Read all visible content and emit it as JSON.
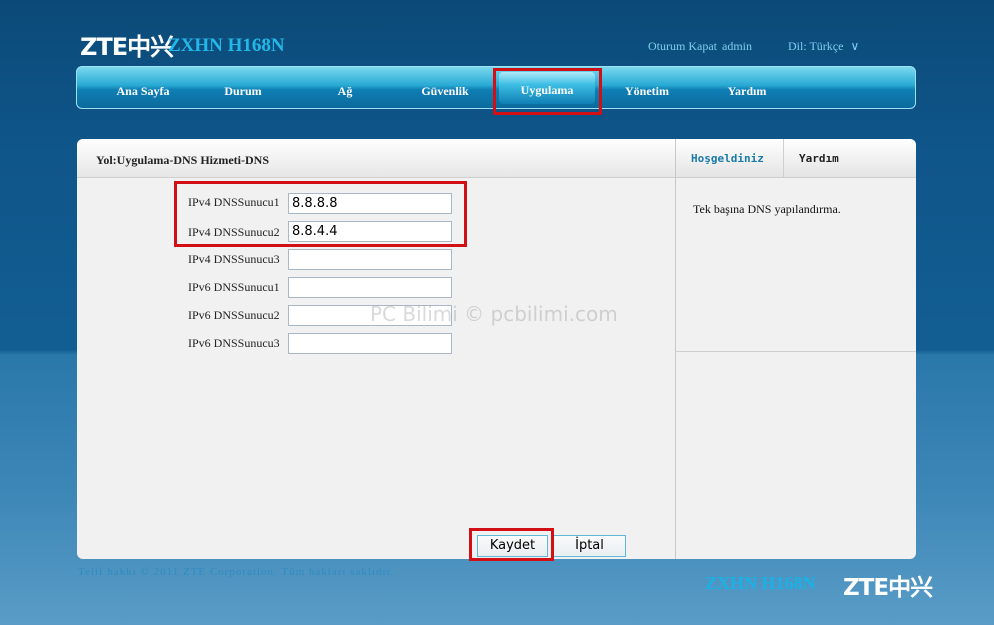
{
  "brand": {
    "logo_text": "ZTE中兴",
    "model": "ZXHN H168N"
  },
  "top_links": {
    "logout": "Oturum Kapat",
    "user": "admin",
    "language": "Dil: Türkçe",
    "language_caret": "∨"
  },
  "nav": [
    "Ana Sayfa",
    "Durum",
    "Ağ",
    "Güvenlik",
    "Uygulama",
    "Yönetim",
    "Yardım"
  ],
  "nav_active": "Uygulama",
  "breadcrumb": "Yol:Uygulama-DNS Hizmeti-DNS",
  "side": {
    "tabs": [
      "Hoşgeldiniz",
      "Yardım"
    ],
    "description": "Tek başına DNS yapılandırma."
  },
  "dns_fields": [
    {
      "label": "IPv4 DNSSunucu1",
      "value": "8.8.8.8"
    },
    {
      "label": "IPv4 DNSSunucu2",
      "value": "8.8.4.4"
    },
    {
      "label": "IPv4 DNSSunucu3",
      "value": ""
    },
    {
      "label": "IPv6 DNSSunucu1",
      "value": ""
    },
    {
      "label": "IPv6 DNSSunucu2",
      "value": ""
    },
    {
      "label": "IPv6 DNSSunucu3",
      "value": ""
    }
  ],
  "buttons": {
    "save": "Kaydet",
    "cancel": "İptal"
  },
  "watermark": "PC Bilimi © pcbilimi.com",
  "footer": {
    "copyright": "Telif hakkı © 2011 ZTE Corporation. Tüm hakları saklıdır.",
    "model": "ZXHN H168N",
    "logo_text": "ZTE中兴"
  },
  "colors": {
    "highlight": "#d10f14",
    "accent": "#1ab2e6",
    "tab_link": "#1a7ba8"
  }
}
